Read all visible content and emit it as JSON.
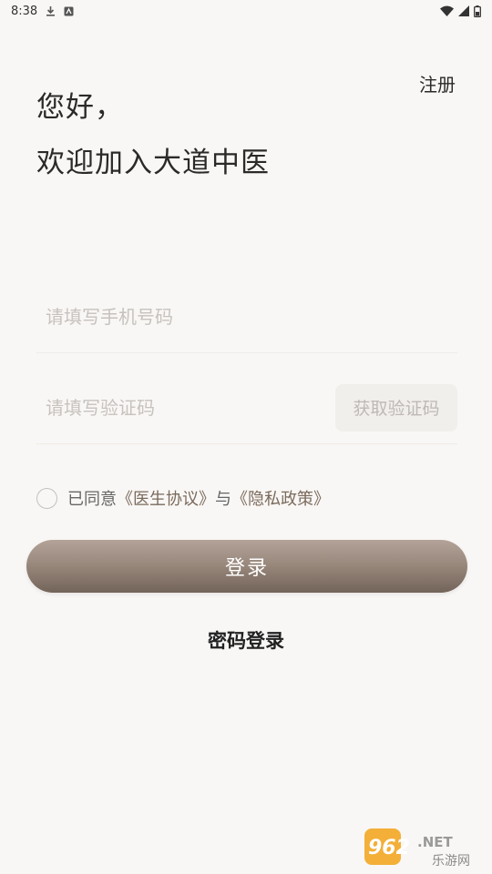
{
  "status_bar": {
    "time": "8:38",
    "icons": [
      "download-icon",
      "notification-icon",
      "wifi-icon",
      "signal-icon",
      "battery-icon"
    ]
  },
  "header": {
    "register_label": "注册"
  },
  "greeting": {
    "line1": "您好，",
    "line2": "欢迎加入大道中医"
  },
  "form": {
    "phone_placeholder": "请填写手机号码",
    "phone_value": "",
    "code_placeholder": "请填写验证码",
    "code_value": "",
    "get_code_label": "获取验证码"
  },
  "agreement": {
    "checked": false,
    "prefix": "已同意",
    "doctor_agreement": "《医生协议》",
    "conjunction": "与",
    "privacy_policy": "《隐私政策》"
  },
  "actions": {
    "login_label": "登录",
    "password_login_label": "密码登录"
  },
  "watermark": {
    "text_main": "962.NET",
    "text_sub": "乐游网"
  },
  "colors": {
    "background": "#f9f7f5",
    "login_gradient_top": "#b4a398",
    "login_gradient_bottom": "#73645a",
    "link": "#7a6a5c"
  }
}
